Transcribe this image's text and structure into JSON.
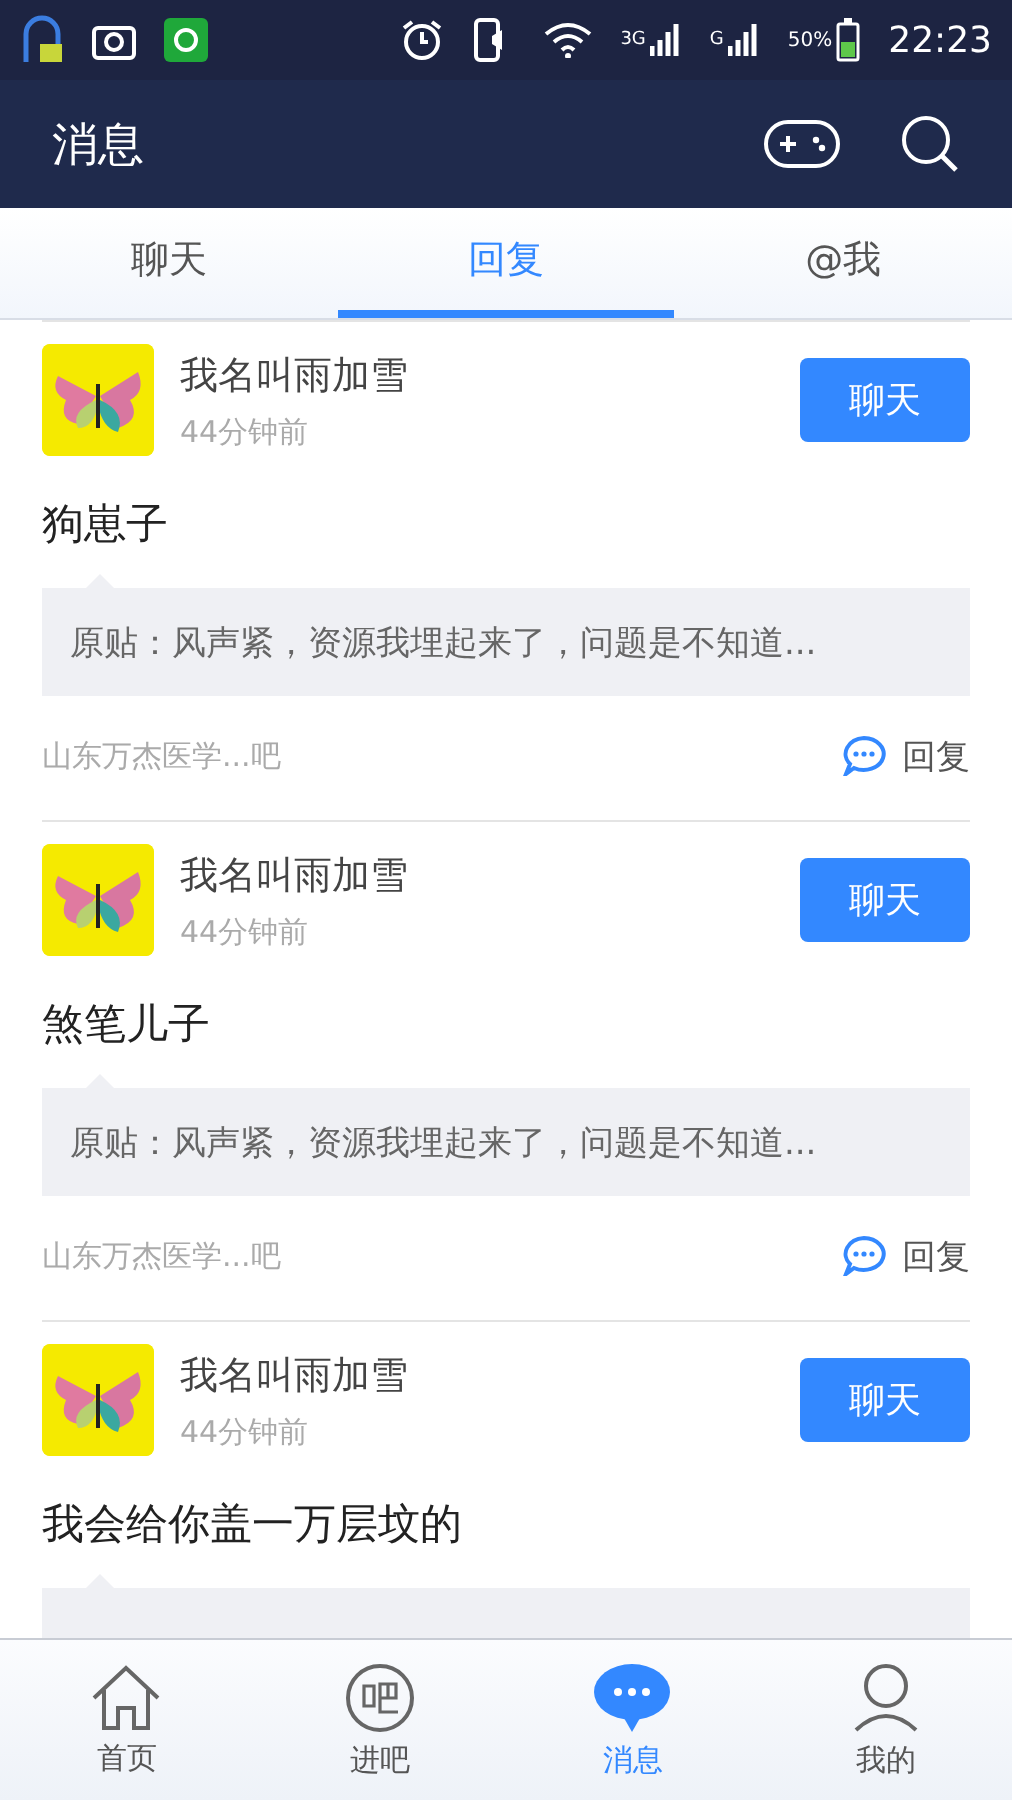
{
  "status_bar": {
    "network_1": "3G",
    "network_2": "G",
    "battery_text": "50%",
    "time": "22:23"
  },
  "header": {
    "title": "消息"
  },
  "tabs": [
    {
      "label": "聊天",
      "selected": false
    },
    {
      "label": "回复",
      "selected": true
    },
    {
      "label": "@我",
      "selected": false
    }
  ],
  "replies": [
    {
      "user": "我名叫雨加雪",
      "time": "44分钟前",
      "action": "聊天",
      "content": "狗崽子",
      "quote": "原贴：风声紧，资源我埋起来了，问题是不知道...",
      "forum": "山东万杰医学...吧",
      "reply": "回复"
    },
    {
      "user": "我名叫雨加雪",
      "time": "44分钟前",
      "action": "聊天",
      "content": "煞笔儿子",
      "quote": "原贴：风声紧，资源我埋起来了，问题是不知道...",
      "forum": "山东万杰医学...吧",
      "reply": "回复"
    },
    {
      "user": "我名叫雨加雪",
      "time": "44分钟前",
      "action": "聊天",
      "content": "我会给你盖一万层坟的"
    }
  ],
  "bottom_nav": [
    {
      "label": "首页",
      "kind": "home",
      "selected": false
    },
    {
      "label": "进吧",
      "kind": "forum",
      "selected": false
    },
    {
      "label": "消息",
      "kind": "message",
      "selected": true
    },
    {
      "label": "我的",
      "kind": "profile",
      "selected": false
    }
  ]
}
